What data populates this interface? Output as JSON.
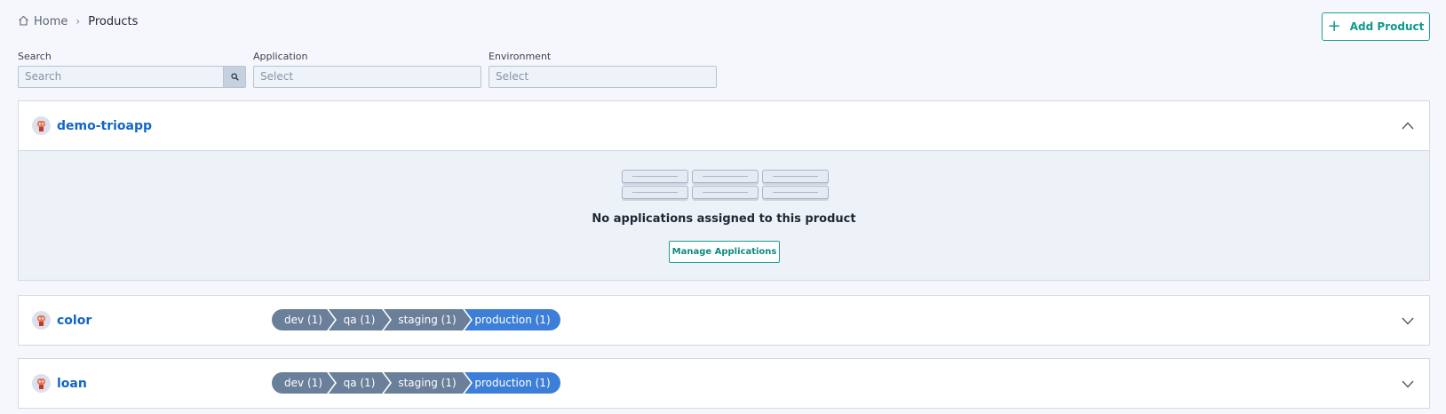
{
  "breadcrumb": {
    "home": "Home",
    "separator": "›",
    "current": "Products"
  },
  "actions": {
    "add_product": "Add Product"
  },
  "filters": {
    "search": {
      "label": "Search",
      "placeholder": "Search"
    },
    "application": {
      "label": "Application",
      "placeholder": "Select"
    },
    "environment": {
      "label": "Environment",
      "placeholder": "Select"
    }
  },
  "products": [
    {
      "name": "demo-trioapp",
      "expanded": true,
      "empty_message": "No applications assigned to this product",
      "manage_label": "Manage Applications"
    },
    {
      "name": "color",
      "expanded": false,
      "stages": [
        "dev (1)",
        "qa (1)",
        "staging (1)",
        "production (1)"
      ]
    },
    {
      "name": "loan",
      "expanded": false,
      "stages": [
        "dev (1)",
        "qa (1)",
        "staging (1)",
        "production (1)"
      ]
    }
  ],
  "colors": {
    "accent": "#1aa092",
    "link": "#1266c7",
    "stage": "#6a7f99",
    "stage_active": "#3d7fd8"
  }
}
